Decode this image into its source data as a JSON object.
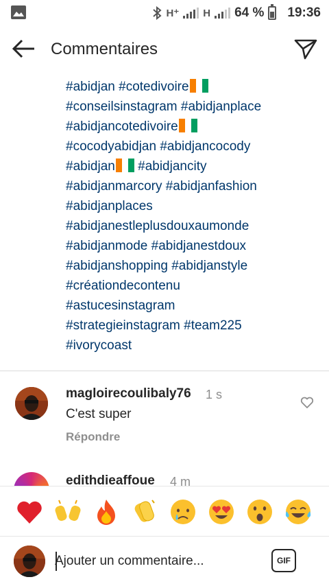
{
  "status_bar": {
    "network_1": "H⁺",
    "network_2": "H",
    "battery": "64 %",
    "battery_level": 0.64,
    "time": "19:36"
  },
  "header": {
    "title": "Commentaires",
    "back_icon": "arrow-left-icon",
    "send_icon": "paper-plane-icon"
  },
  "caption": {
    "lines": [
      {
        "text": "#abidjan #cotedivoire",
        "flag": true
      },
      {
        "text": "#conseilsinstagram #abidjanplace",
        "flag": false
      },
      {
        "text": "#abidjancotedivoire",
        "flag": true
      },
      {
        "text": "#cocodyabidjan #abidjancocody",
        "flag": false
      },
      {
        "text": "#abidjan",
        "flag": true,
        "after": " #abidjancity"
      },
      {
        "text": "#abidjanmarcory #abidjanfashion",
        "flag": false
      },
      {
        "text": "#abidjanplaces",
        "flag": false
      },
      {
        "text": "#abidjanestleplusdouxaumonde",
        "flag": false
      },
      {
        "text": "#abidjanmode #abidjanestdoux",
        "flag": false
      },
      {
        "text": "#abidjanshopping #abidjanstyle",
        "flag": false
      },
      {
        "text": "#créationdecontenu",
        "flag": false
      },
      {
        "text": "#astucesinstagram",
        "flag": false
      },
      {
        "text": "#strategieinstagram #team225",
        "flag": false
      },
      {
        "text": "#ivorycoast",
        "flag": false
      }
    ],
    "link_color": "#00376b"
  },
  "comments": [
    {
      "username": "magloirecoulibaly76",
      "time": "1 s",
      "text": "C'est super",
      "reply": "Répondre"
    },
    {
      "username": "edithdieaffoue",
      "time": "4 m"
    }
  ],
  "emoji_bar": [
    "❤️",
    "🙌",
    "🔥",
    "👏",
    "😢",
    "😍",
    "😮",
    "😂"
  ],
  "input_bar": {
    "placeholder": "Ajouter un commentaire...",
    "gif_label": "GIF"
  },
  "colors": {
    "flag_orange": "#f77f00",
    "flag_white": "#ffffff",
    "flag_green": "#009e60"
  }
}
